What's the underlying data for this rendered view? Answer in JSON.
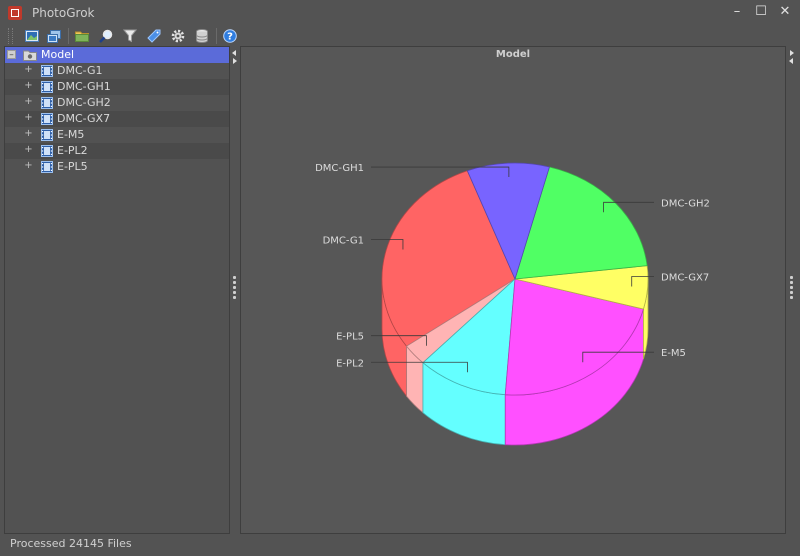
{
  "window": {
    "title": "PhotoGrok",
    "controls": [
      "–",
      "☐",
      "✕"
    ]
  },
  "toolbar": {
    "buttons": [
      "image-icon",
      "gallery-icon",
      "folder-icon",
      "search-icon",
      "filter-icon",
      "tag-icon",
      "gear-icon",
      "database-icon",
      "help-icon"
    ]
  },
  "tree": {
    "root": {
      "label": "Model",
      "expander": "–"
    },
    "items": [
      {
        "label": "DMC-G1",
        "expander": "+"
      },
      {
        "label": "DMC-GH1",
        "expander": "+"
      },
      {
        "label": "DMC-GH2",
        "expander": "+"
      },
      {
        "label": "DMC-GX7",
        "expander": "+"
      },
      {
        "label": "E-M5",
        "expander": "+"
      },
      {
        "label": "E-PL2",
        "expander": "+"
      },
      {
        "label": "E-PL5",
        "expander": "+"
      }
    ]
  },
  "chart_data": {
    "type": "pie",
    "title": "Model",
    "three_d": true,
    "start_angle_deg": 111,
    "direction": "counterclockwise",
    "slices": [
      {
        "label": "DMC-G1",
        "value": 29,
        "color": "#ff6464"
      },
      {
        "label": "E-PL5",
        "value": 3,
        "color": "#ffb4b4"
      },
      {
        "label": "E-PL2",
        "value": 11,
        "color": "#64ffff"
      },
      {
        "label": "E-M5",
        "value": 22,
        "color": "#ff50ff"
      },
      {
        "label": "DMC-GX7",
        "value": 6,
        "color": "#ffff64"
      },
      {
        "label": "DMC-GH2",
        "value": 19,
        "color": "#50ff64"
      },
      {
        "label": "DMC-GH1",
        "value": 10,
        "color": "#7864ff"
      }
    ]
  },
  "status": {
    "text": "Processed 24145 Files"
  }
}
